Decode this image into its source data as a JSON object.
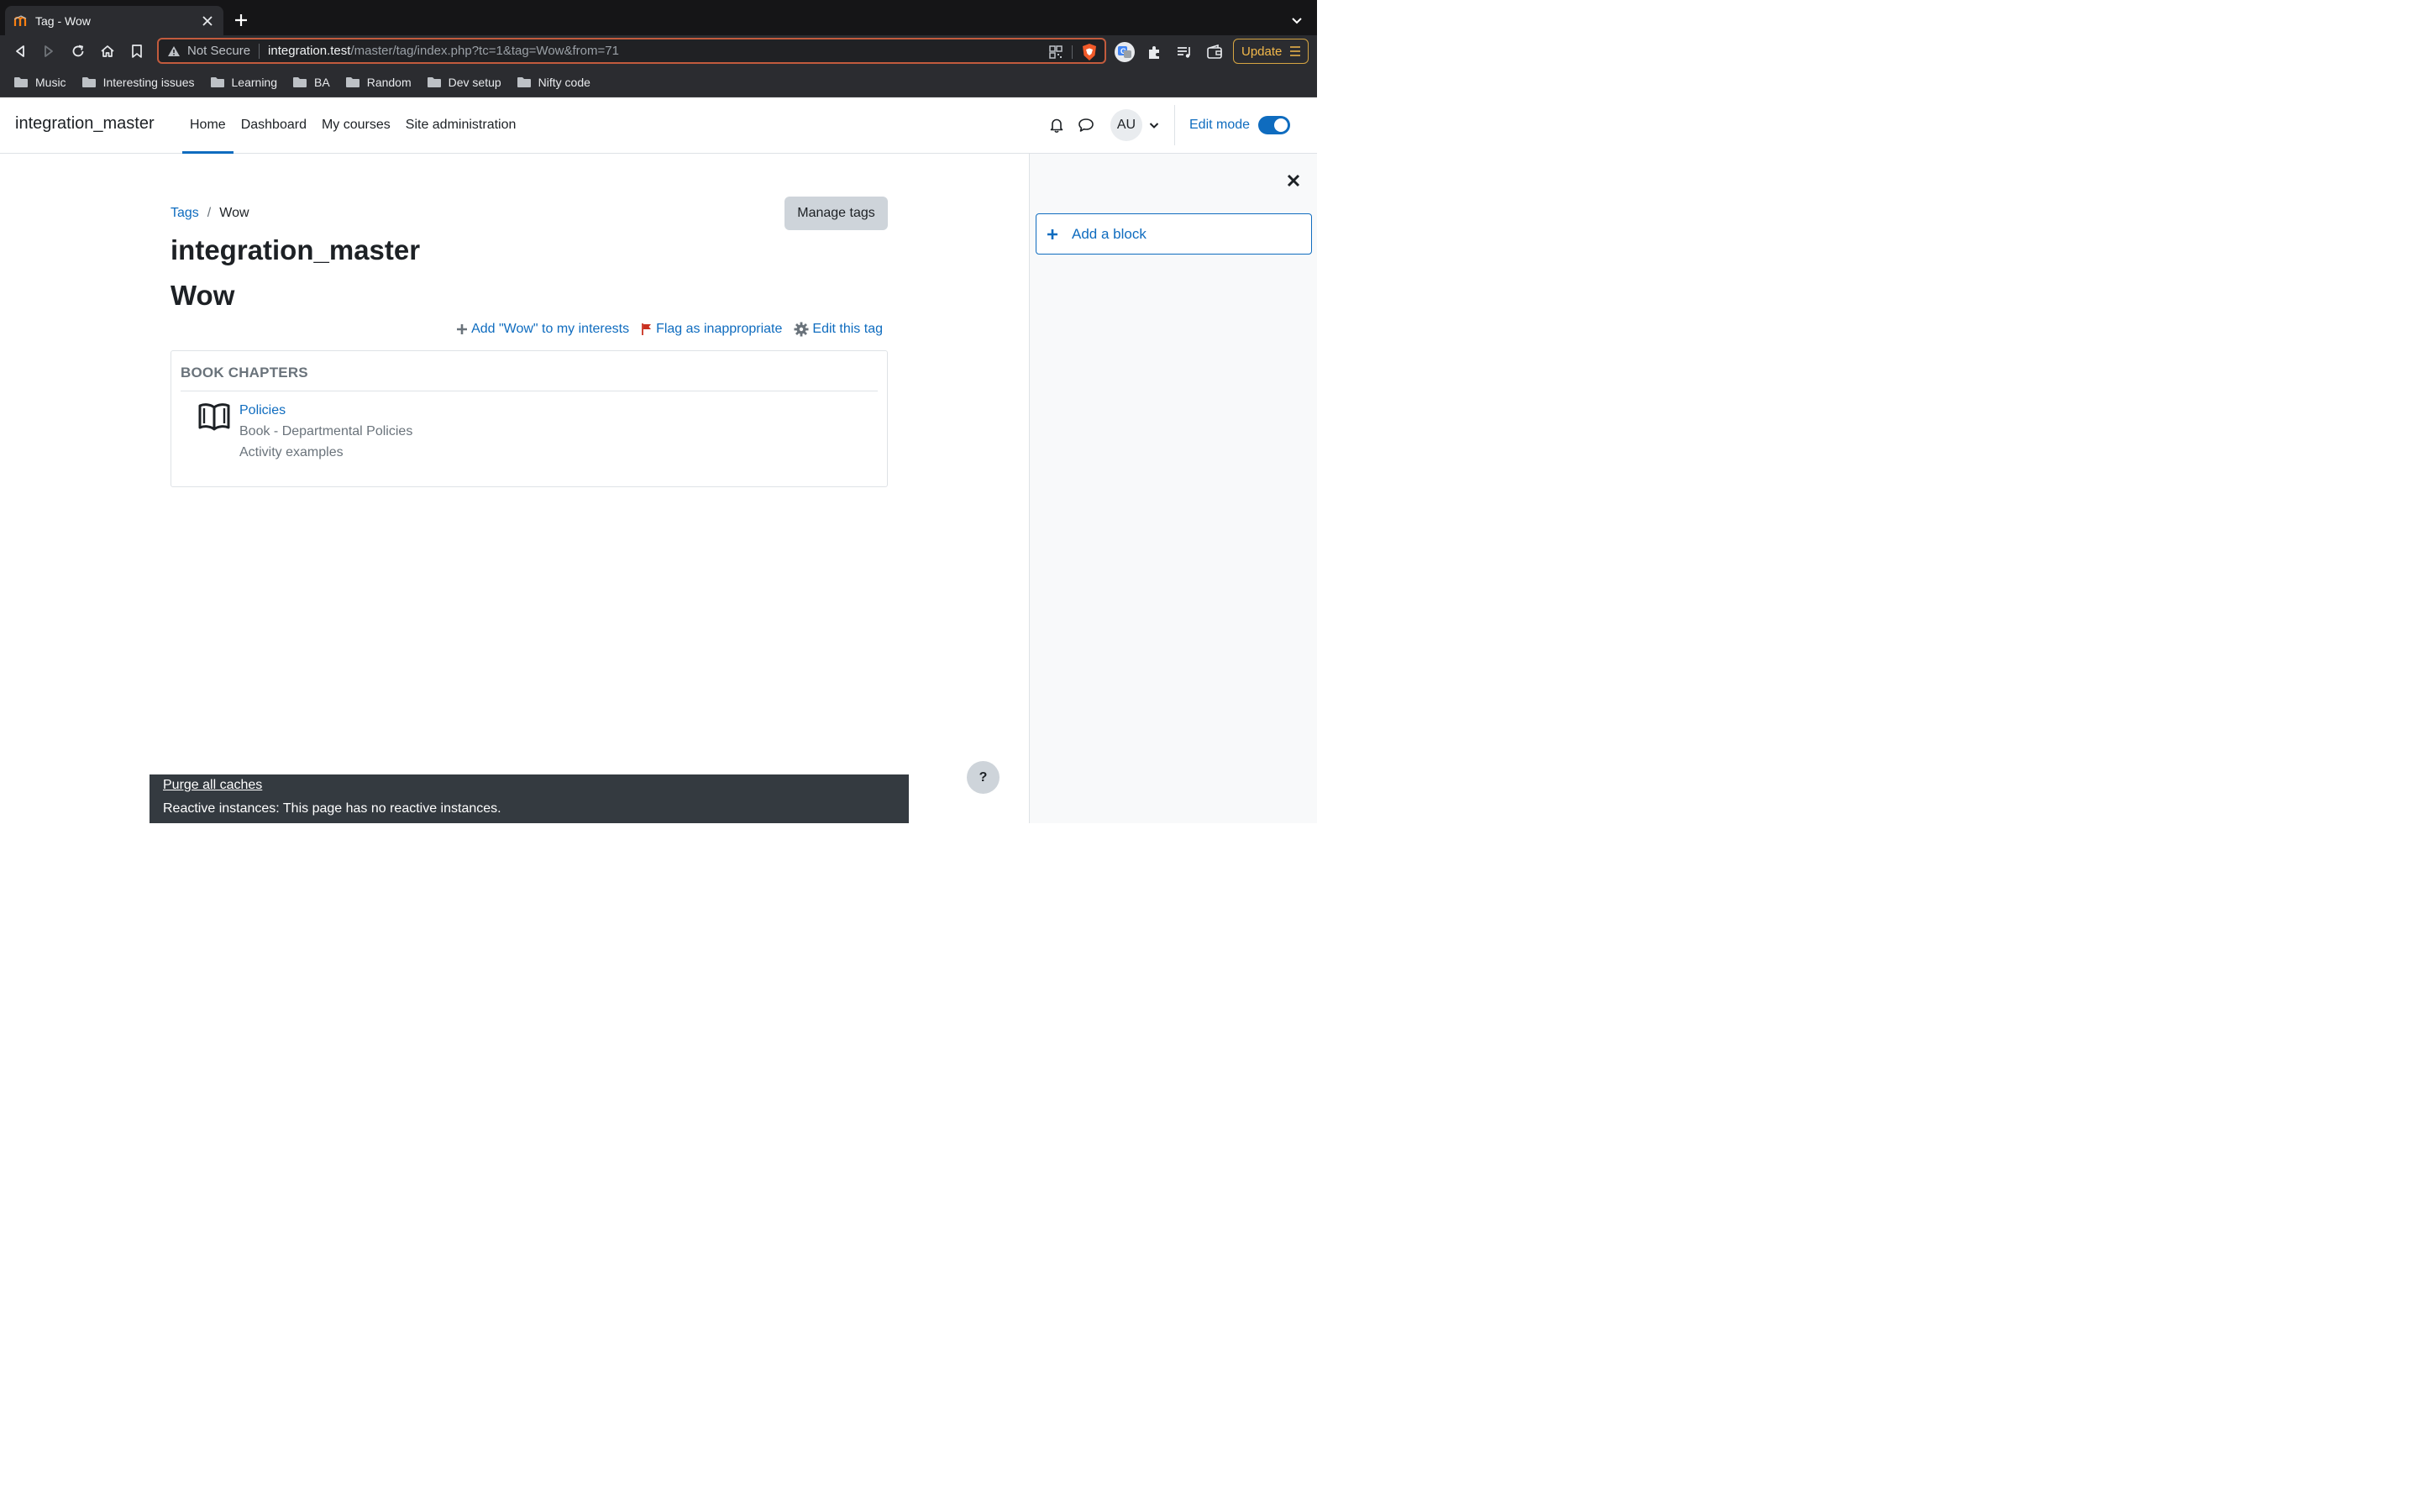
{
  "browser": {
    "tab": {
      "title": "Tag - Wow",
      "favicon": "moodle-icon"
    },
    "address": {
      "security_label": "Not Secure",
      "host": "integration.test",
      "path": "/master/tag/index.php?tc=1&tag=Wow&from=71"
    },
    "update_label": "Update",
    "bookmarks": [
      {
        "label": "Music"
      },
      {
        "label": "Interesting issues"
      },
      {
        "label": "Learning"
      },
      {
        "label": "BA"
      },
      {
        "label": "Random"
      },
      {
        "label": "Dev setup"
      },
      {
        "label": "Nifty code"
      }
    ]
  },
  "navbar": {
    "brand": "integration_master",
    "items": [
      {
        "label": "Home",
        "active": true
      },
      {
        "label": "Dashboard"
      },
      {
        "label": "My courses"
      },
      {
        "label": "Site administration"
      }
    ],
    "user_initials": "AU",
    "edit_mode_label": "Edit mode",
    "edit_mode_on": true
  },
  "drawer": {
    "add_block_label": "Add a block"
  },
  "main": {
    "breadcrumb": {
      "parent": "Tags",
      "separator": "/",
      "current": "Wow"
    },
    "manage_tags_label": "Manage tags",
    "site_title": "integration_master",
    "tag_title": "Wow",
    "actions": {
      "add_interest": "Add \"Wow\" to my interests",
      "flag": "Flag as inappropriate",
      "edit": "Edit this tag"
    },
    "section": {
      "header": "BOOK CHAPTERS",
      "items": [
        {
          "name": "Policies",
          "context": "Book - Departmental Policies",
          "course": "Activity examples",
          "icon": "book-icon"
        }
      ]
    }
  },
  "footer": {
    "purge_label": "Purge all caches",
    "reactive_text": "Reactive instances: This page has no reactive instances."
  },
  "help_label": "?",
  "colors": {
    "accent": "#0f6cbf",
    "chrome_bg": "#202124",
    "update_accent": "#f2b84b",
    "footer_bg": "#343a40"
  }
}
